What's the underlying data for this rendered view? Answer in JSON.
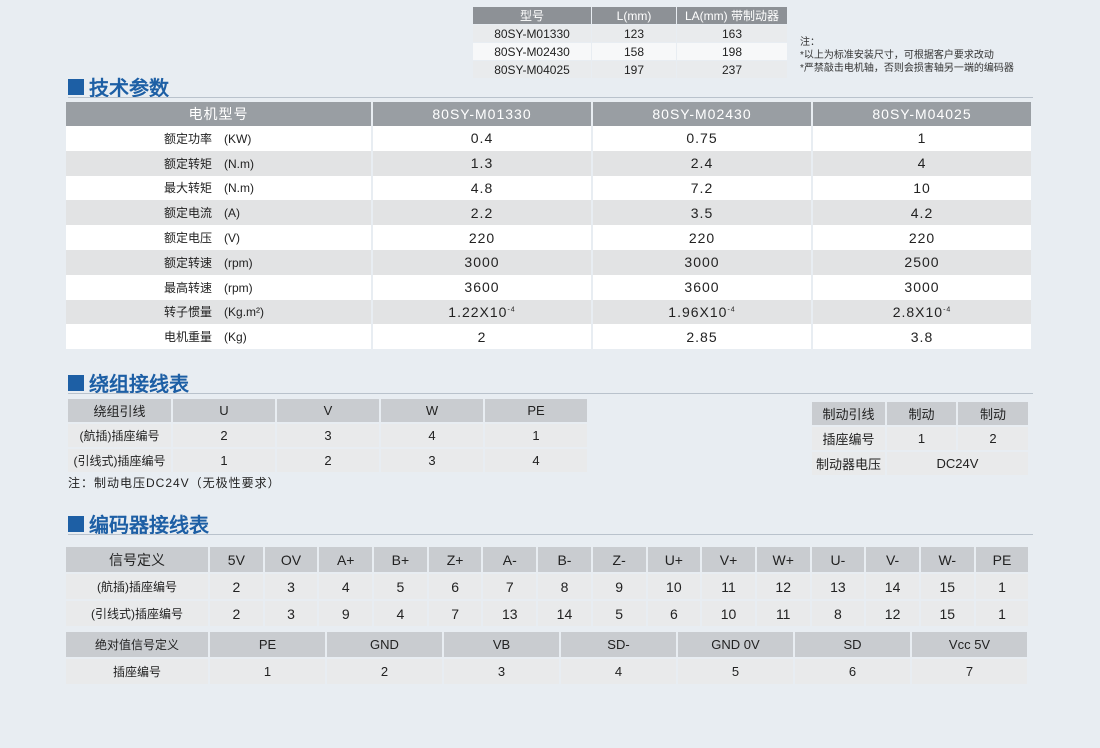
{
  "la_table": {
    "headers": [
      "型号",
      "L(mm)",
      "LA(mm) 带制动器"
    ],
    "rows": [
      [
        "80SY-M01330",
        "123",
        "163"
      ],
      [
        "80SY-M02430",
        "158",
        "198"
      ],
      [
        "80SY-M04025",
        "197",
        "237"
      ]
    ]
  },
  "notes": {
    "title": "注：",
    "line1": "*以上为标准安装尺寸，可根据客户要求改动",
    "line2": "*严禁敲击电机轴，否则会损害轴另一端的编码器"
  },
  "spec": {
    "title": "技术参数",
    "header_label": "电机型号",
    "models": [
      "80SY-M01330",
      "80SY-M02430",
      "80SY-M04025"
    ],
    "rows": [
      {
        "name": "额定功率",
        "unit": "(KW)",
        "values": [
          "0.4",
          "0.75",
          "1"
        ]
      },
      {
        "name": "额定转矩",
        "unit": "(N.m)",
        "values": [
          "1.3",
          "2.4",
          "4"
        ]
      },
      {
        "name": "最大转矩",
        "unit": "(N.m)",
        "values": [
          "4.8",
          "7.2",
          "10"
        ]
      },
      {
        "name": "额定电流",
        "unit": "(A)",
        "values": [
          "2.2",
          "3.5",
          "4.2"
        ]
      },
      {
        "name": "额定电压",
        "unit": "(V)",
        "values": [
          "220",
          "220",
          "220"
        ]
      },
      {
        "name": "额定转速",
        "unit": "(rpm)",
        "values": [
          "3000",
          "3000",
          "2500"
        ]
      },
      {
        "name": "最高转速",
        "unit": "(rpm)",
        "values": [
          "3600",
          "3600",
          "3000"
        ]
      },
      {
        "name": "转子惯量",
        "unit": "(Kg.m²)",
        "values": [
          "1.22X10",
          "1.96X10",
          "2.8X10"
        ],
        "exp": "-4"
      },
      {
        "name": "电机重量",
        "unit": "(Kg)",
        "values": [
          "2",
          "2.85",
          "3.8"
        ]
      }
    ]
  },
  "winding": {
    "title": "绕组接线表",
    "header": [
      "绕组引线",
      "U",
      "V",
      "W",
      "PE"
    ],
    "rows": [
      [
        "(航插)插座编号",
        "2",
        "3",
        "4",
        "1"
      ],
      [
        "(引线式)插座编号",
        "1",
        "2",
        "3",
        "4"
      ]
    ],
    "note": "注：制动电压DC24V（无极性要求）"
  },
  "brake": {
    "header": [
      "制动引线",
      "制动",
      "制动"
    ],
    "row1": [
      "插座编号",
      "1",
      "2"
    ],
    "row2": [
      "制动器电压",
      "DC24V"
    ]
  },
  "encoder": {
    "title": "编码器接线表",
    "header": [
      "信号定义",
      "5V",
      "OV",
      "A+",
      "B+",
      "Z+",
      "A-",
      "B-",
      "Z-",
      "U+",
      "V+",
      "W+",
      "U-",
      "V-",
      "W-",
      "PE"
    ],
    "rows": [
      [
        "(航插)插座编号",
        "2",
        "3",
        "4",
        "5",
        "6",
        "7",
        "8",
        "9",
        "10",
        "11",
        "12",
        "13",
        "14",
        "15",
        "1"
      ],
      [
        "(引线式)插座编号",
        "2",
        "3",
        "9",
        "4",
        "7",
        "13",
        "14",
        "5",
        "6",
        "10",
        "11",
        "8",
        "12",
        "15",
        "1"
      ]
    ]
  },
  "absolute": {
    "header": [
      "绝对值信号定义",
      "PE",
      "GND",
      "VB",
      "SD-",
      "GND 0V",
      "SD",
      "Vcc 5V"
    ],
    "row": [
      "插座编号",
      "1",
      "2",
      "3",
      "4",
      "5",
      "6",
      "7"
    ]
  },
  "colors": {
    "accent": "#1d5fa5",
    "header_dark": "#999ea3",
    "header_light": "#c9ccd0"
  }
}
